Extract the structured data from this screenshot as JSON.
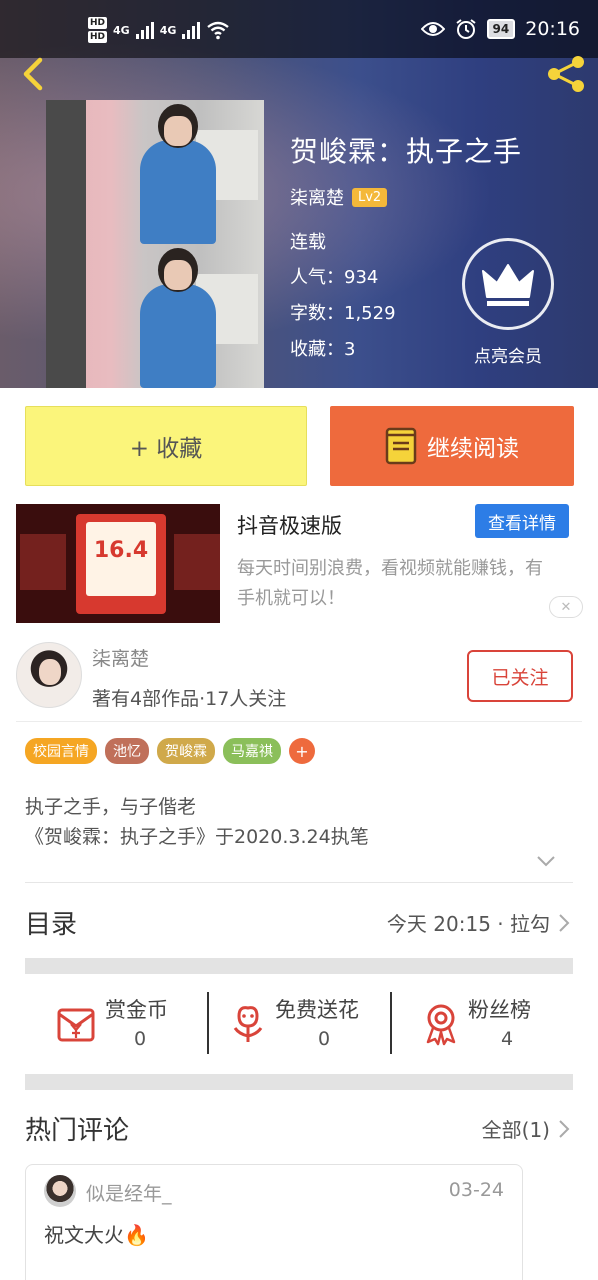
{
  "status_bar": {
    "hd1": "HD",
    "hd2": "HD",
    "net1": "4G",
    "net2": "4G",
    "battery": "94",
    "time": "20:16"
  },
  "book": {
    "title": "贺峻霖：执子之手",
    "author": "柒离楚",
    "level": "Lv2",
    "status": "连载",
    "popularity": "人气：934",
    "word_count": "字数：1,529",
    "favorites": "收藏：3",
    "vip_label": "点亮会员"
  },
  "buttons": {
    "favorite": "+ 收藏",
    "continue_read": "继续阅读"
  },
  "ad": {
    "image_amount": "16.4",
    "title": "抖音极速版",
    "cta": "查看详情",
    "desc": "每天时间别浪费，看视频就能赚钱，有手机就可以！",
    "close": "✕"
  },
  "author_card": {
    "name": "柒离楚",
    "meta": "著有4部作品·17人关注",
    "follow": "已关注"
  },
  "tags": [
    {
      "label": "校园言情",
      "color": "#f5a623"
    },
    {
      "label": "池忆",
      "color": "#c0705a"
    },
    {
      "label": "贺峻霖",
      "color": "#d0a94a"
    },
    {
      "label": "马嘉祺",
      "color": "#8bbf5a"
    }
  ],
  "tag_plus": "+",
  "description": {
    "line1": "执子之手，与子偕老",
    "line2": "《贺峻霖：执子之手》于2020.3.24执笔"
  },
  "catalog": {
    "title": "目录",
    "latest": "今天 20:15 · 拉勾"
  },
  "actions": [
    {
      "label": "赏金币",
      "value": "0"
    },
    {
      "label": "免费送花",
      "value": "0"
    },
    {
      "label": "粉丝榜",
      "value": "4"
    }
  ],
  "hot_comments": {
    "title": "热门评论",
    "all": "全部(1)"
  },
  "comment": {
    "user": "似是经年_",
    "date": "03-24",
    "text": "祝文大火🔥"
  }
}
